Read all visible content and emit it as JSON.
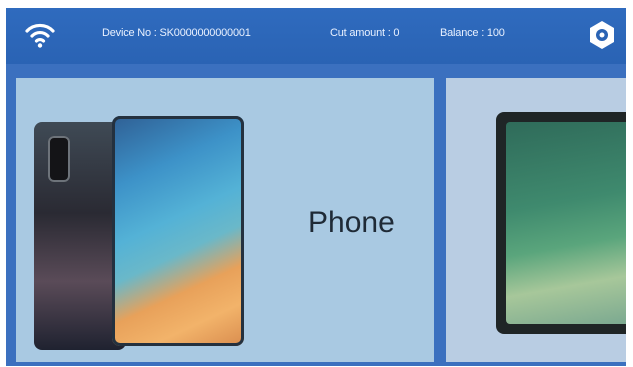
{
  "status_bar": {
    "device_no": "Device No : SK0000000000001",
    "cut_amount": "Cut amount : 0",
    "balance": "Balance : 100"
  },
  "icons": {
    "wifi": "wifi-icon",
    "settings": "settings-icon"
  },
  "cards": [
    {
      "label": "Phone"
    },
    {
      "label": ""
    }
  ],
  "colors": {
    "header": "#2a63b4",
    "card": "#a9c9e2",
    "header_text": "#e9f1ff"
  }
}
